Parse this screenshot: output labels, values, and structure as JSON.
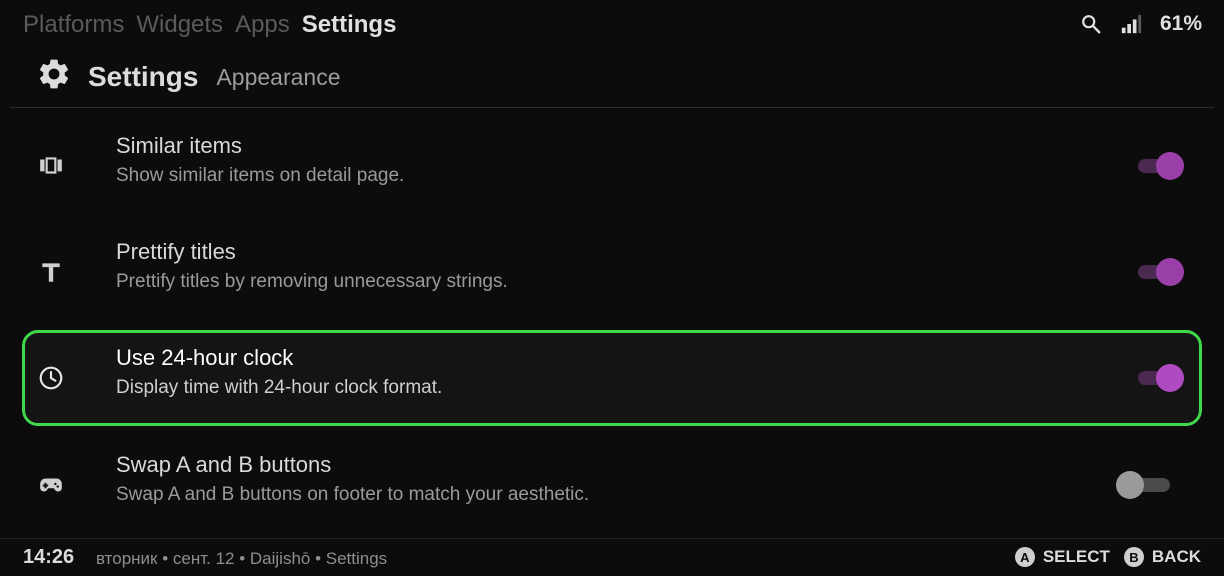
{
  "top_nav": {
    "tabs": [
      {
        "label": "Platforms",
        "active": false
      },
      {
        "label": "Widgets",
        "active": false
      },
      {
        "label": "Apps",
        "active": false
      },
      {
        "label": "Settings",
        "active": true
      }
    ]
  },
  "status": {
    "search_icon": "search-icon",
    "signal_icon": "signal-icon",
    "battery": "61%"
  },
  "header": {
    "icon": "gear-icon",
    "title": "Settings",
    "subtitle": "Appearance"
  },
  "settings": [
    {
      "icon": "carousel-icon",
      "title": "Similar items",
      "description": "Show similar items on detail page.",
      "enabled": true,
      "focused": false
    },
    {
      "icon": "text-icon",
      "title": "Prettify titles",
      "description": "Prettify titles by removing unnecessary strings.",
      "enabled": true,
      "focused": false
    },
    {
      "icon": "clock-icon",
      "title": "Use 24-hour clock",
      "description": "Display time with 24-hour clock format.",
      "enabled": true,
      "focused": true
    },
    {
      "icon": "gamepad-icon",
      "title": "Swap A and B buttons",
      "description": "Swap A and B buttons on footer to match your aesthetic.",
      "enabled": false,
      "focused": false
    }
  ],
  "footer": {
    "time": "14:26",
    "info": "вторник • сент. 12 • Daijishō • Settings",
    "actions": [
      {
        "button": "A",
        "label": "SELECT"
      },
      {
        "button": "B",
        "label": "BACK"
      }
    ]
  },
  "colors": {
    "background": "#0c0c0c",
    "toggle_on": "#9b3fa8",
    "focus_border": "#3fd84a"
  }
}
